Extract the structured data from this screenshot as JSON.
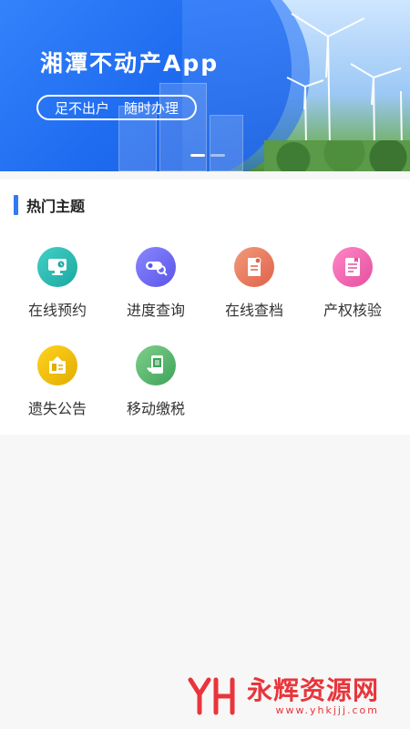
{
  "banner": {
    "title": "湘潭不动产App",
    "tagline_left": "足不出户",
    "tagline_right": "随时办理",
    "carousel_dots": 2,
    "active_dot": 0
  },
  "section": {
    "title": "热门主题",
    "items": [
      {
        "label": "在线预约",
        "icon": "monitor-clock-icon",
        "color": "#2bbbb3"
      },
      {
        "label": "进度查询",
        "icon": "search-progress-icon",
        "color": "#6e6bf5"
      },
      {
        "label": "在线查档",
        "icon": "document-search-icon",
        "color": "#e9785c"
      },
      {
        "label": "产权核验",
        "icon": "certificate-icon",
        "color": "#f06ab3"
      },
      {
        "label": "遗失公告",
        "icon": "notice-board-icon",
        "color": "#f2c000"
      },
      {
        "label": "移动缴税",
        "icon": "mobile-tax-icon",
        "color": "#55b86e"
      }
    ]
  },
  "watermark": {
    "brand": "永辉资源网",
    "url": "www.yhkjjj.com",
    "color": "#e8353b"
  }
}
